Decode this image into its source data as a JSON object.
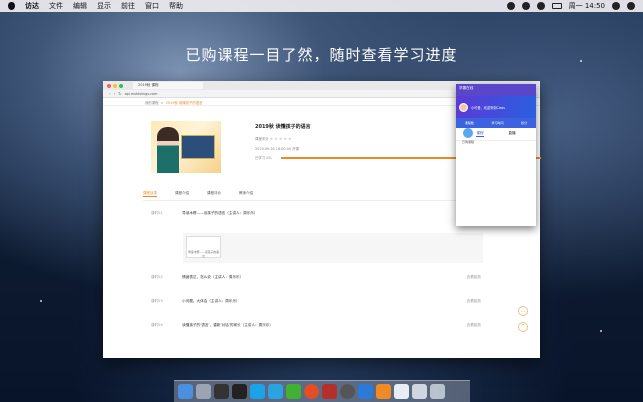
{
  "menubar": {
    "app_name": "访达",
    "menus": [
      "文件",
      "编辑",
      "显示",
      "前往",
      "窗口",
      "帮助"
    ],
    "clock": "周一 14:50"
  },
  "headline": "已购课程一目了然，随时查看学习进度",
  "browser": {
    "tab_title": "2019秋  课程",
    "url": "api.mshtslings.com",
    "breadcrumb": [
      "我的课程",
      "2019秋 读懂孩子的语言"
    ]
  },
  "course": {
    "title": "2019秋  读懂孩子的语言",
    "meta1": "课程评分",
    "meta2": "2019-09-26 18:00:00 开课",
    "meta3": "已学习 0%"
  },
  "section_tabs": [
    "课程目录",
    "课程介绍",
    "课程评价",
    "教师介绍"
  ],
  "lessons": [
    {
      "num": "课时01",
      "title": "导读木楞——谈孩子的语言（主讲人：周乐乐）",
      "action": ""
    },
    {
      "num": "课时02",
      "title": "情绪表达，怎么说（主讲人：周乐乐）",
      "action": "查看回放"
    },
    {
      "num": "课时03",
      "title": "小问题，大体会（主讲人：周乐乐）",
      "action": "查看回放"
    },
    {
      "num": "课时04",
      "title": "读懂孩子的‘语言’，重新‘对话’的家长（主讲人：周乐乐）",
      "action": "查看回放"
    }
  ],
  "video_card_label": "导读木楞——谈孩子的语言",
  "panel": {
    "header": "学霸在线",
    "user": "小可爱，欢迎来到Class",
    "stats": [
      "课程数",
      "学习时间",
      "积分"
    ],
    "tabs": [
      "课程",
      "直播"
    ],
    "item": "已购课程"
  },
  "colors": {
    "accent": "#f08a24",
    "panel_brand": "#5a46c8"
  }
}
